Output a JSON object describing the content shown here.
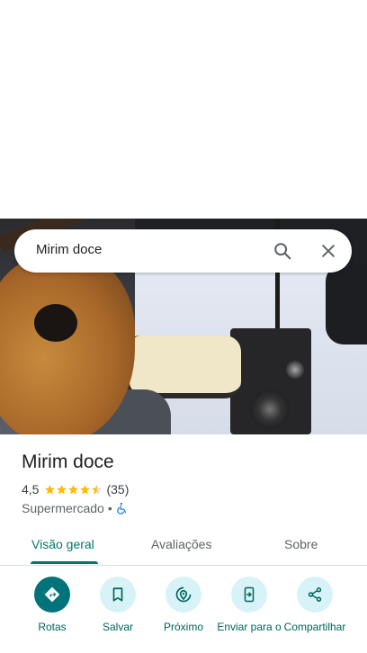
{
  "search": {
    "query": "Mirim doce"
  },
  "place": {
    "name": "Mirim doce",
    "rating": "4,5",
    "stars_filled": 4.5,
    "review_count": "(35)",
    "category": "Supermercado",
    "separator": "•"
  },
  "tabs": [
    {
      "label": "Visão geral",
      "active": true
    },
    {
      "label": "Avaliações",
      "active": false
    },
    {
      "label": "Sobre",
      "active": false
    }
  ],
  "actions": [
    {
      "label": "Rotas",
      "icon": "directions-icon"
    },
    {
      "label": "Salvar",
      "icon": "bookmark-icon"
    },
    {
      "label": "Próximo",
      "icon": "nearby-icon"
    },
    {
      "label": "Enviar para o",
      "icon": "send-to-phone-icon"
    },
    {
      "label": "Compartilhar",
      "icon": "share-icon"
    }
  ],
  "colors": {
    "accent": "#00796b",
    "primary_action": "#00747a",
    "action_bg": "#d8f3f7",
    "star": "#fbbc04"
  }
}
